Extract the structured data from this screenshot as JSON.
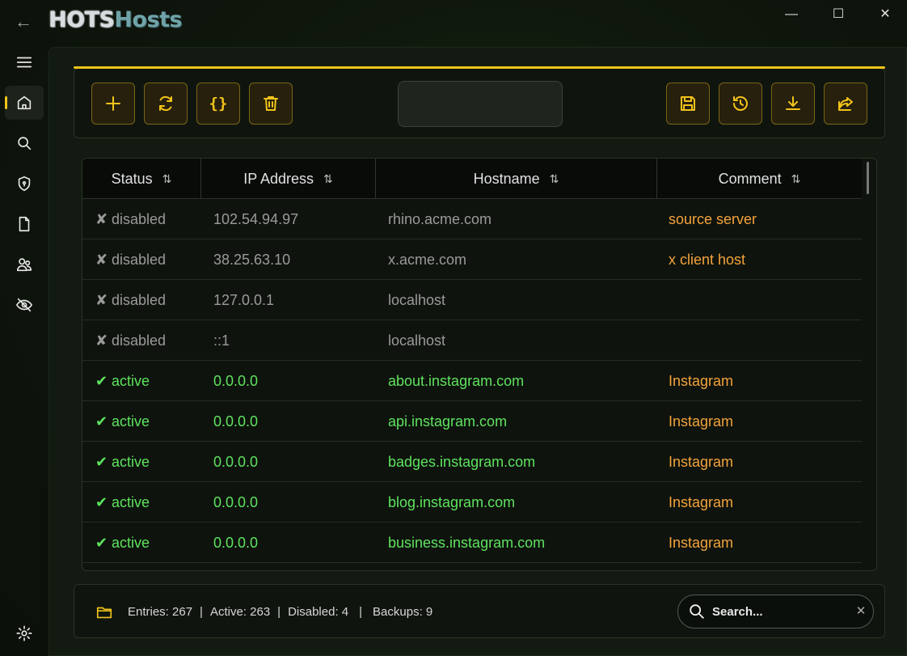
{
  "app": {
    "title_part1": "HOTS",
    "title_part2": "Hosts"
  },
  "window_controls": {
    "minimize": "—",
    "maximize": "☐",
    "close": "✕",
    "back": "←"
  },
  "sidebar": {
    "items": [
      {
        "name": "menu",
        "icon": "hamburger-icon"
      },
      {
        "name": "home",
        "icon": "home-icon",
        "selected": true
      },
      {
        "name": "search",
        "icon": "search-icon"
      },
      {
        "name": "security",
        "icon": "shield-icon"
      },
      {
        "name": "documents",
        "icon": "document-icon"
      },
      {
        "name": "users",
        "icon": "users-icon"
      },
      {
        "name": "hidden",
        "icon": "eye-off-icon"
      }
    ],
    "settings_icon": "gear-icon"
  },
  "toolbar": {
    "left_buttons": [
      "add",
      "refresh",
      "json",
      "delete"
    ],
    "right_buttons": [
      "save",
      "restore",
      "download",
      "share"
    ],
    "json_label": "{}"
  },
  "table": {
    "columns": [
      "Status",
      "IP Address",
      "Hostname",
      "Comment"
    ],
    "sort_glyph": "⇅",
    "rows": [
      {
        "mark": "✘",
        "status": "disabled",
        "ip": "102.54.94.97",
        "host": "rhino.acme.com",
        "comment": "source server",
        "active": false
      },
      {
        "mark": "✘",
        "status": "disabled",
        "ip": "38.25.63.10",
        "host": "x.acme.com",
        "comment": "x client host",
        "active": false
      },
      {
        "mark": "✘",
        "status": "disabled",
        "ip": "127.0.0.1",
        "host": "localhost",
        "comment": "",
        "active": false
      },
      {
        "mark": "✘",
        "status": "disabled",
        "ip": "::1",
        "host": "localhost",
        "comment": "",
        "active": false
      },
      {
        "mark": "✔",
        "status": "active",
        "ip": "0.0.0.0",
        "host": "about.instagram.com",
        "comment": "Instagram",
        "active": true
      },
      {
        "mark": "✔",
        "status": "active",
        "ip": "0.0.0.0",
        "host": "api.instagram.com",
        "comment": "Instagram",
        "active": true
      },
      {
        "mark": "✔",
        "status": "active",
        "ip": "0.0.0.0",
        "host": "badges.instagram.com",
        "comment": "Instagram",
        "active": true
      },
      {
        "mark": "✔",
        "status": "active",
        "ip": "0.0.0.0",
        "host": "blog.instagram.com",
        "comment": "Instagram",
        "active": true
      },
      {
        "mark": "✔",
        "status": "active",
        "ip": "0.0.0.0",
        "host": "business.instagram.com",
        "comment": "Instagram",
        "active": true
      }
    ]
  },
  "statusbar": {
    "entries": "Entries: 267",
    "active": "Active: 263",
    "disabled": "Disabled: 4",
    "backups": "Backups: 9",
    "sep": "|"
  },
  "search": {
    "placeholder": "Search...",
    "clear": "✕"
  },
  "colors": {
    "accent": "#f2c31a",
    "active": "#5ee35e",
    "comment": "#f4a33b",
    "disabled": "#9a9a9a"
  }
}
